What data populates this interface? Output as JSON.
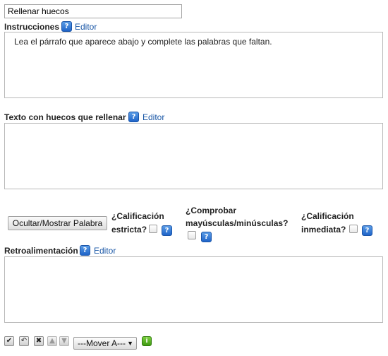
{
  "title_field": {
    "value": "Rellenar huecos"
  },
  "instructions": {
    "label": "Instrucciones",
    "help_icon": "help-icon",
    "editor_link": "Editor",
    "text": "Lea el párrafo que aparece abajo y complete las palabras que faltan."
  },
  "gap_text": {
    "label": "Texto con huecos que rellenar",
    "help_icon": "help-icon",
    "editor_link": "Editor",
    "text": ""
  },
  "options": {
    "toggle_button": "Ocultar/Mostrar Palabra",
    "strict": {
      "line1": "¿Calificación",
      "line2": "estricta?"
    },
    "case_check": {
      "line1": "¿Comprobar",
      "line2": "mayúsculas/minúsculas?"
    },
    "instant": {
      "line1": "¿Calificación",
      "line2": "inmediata?"
    }
  },
  "feedback": {
    "label": "Retroalimentación",
    "help_icon": "help-icon",
    "editor_link": "Editor",
    "text": ""
  },
  "toolbar": {
    "icons": [
      "checkmark-icon",
      "undo-icon",
      "delete-icon",
      "move-up-icon",
      "move-down-icon",
      "info-icon"
    ],
    "move_select": "---Mover A---"
  },
  "colors": {
    "link": "#1a57a6",
    "help_icon": "#2f75d6",
    "info_icon": "#4caf1c"
  }
}
